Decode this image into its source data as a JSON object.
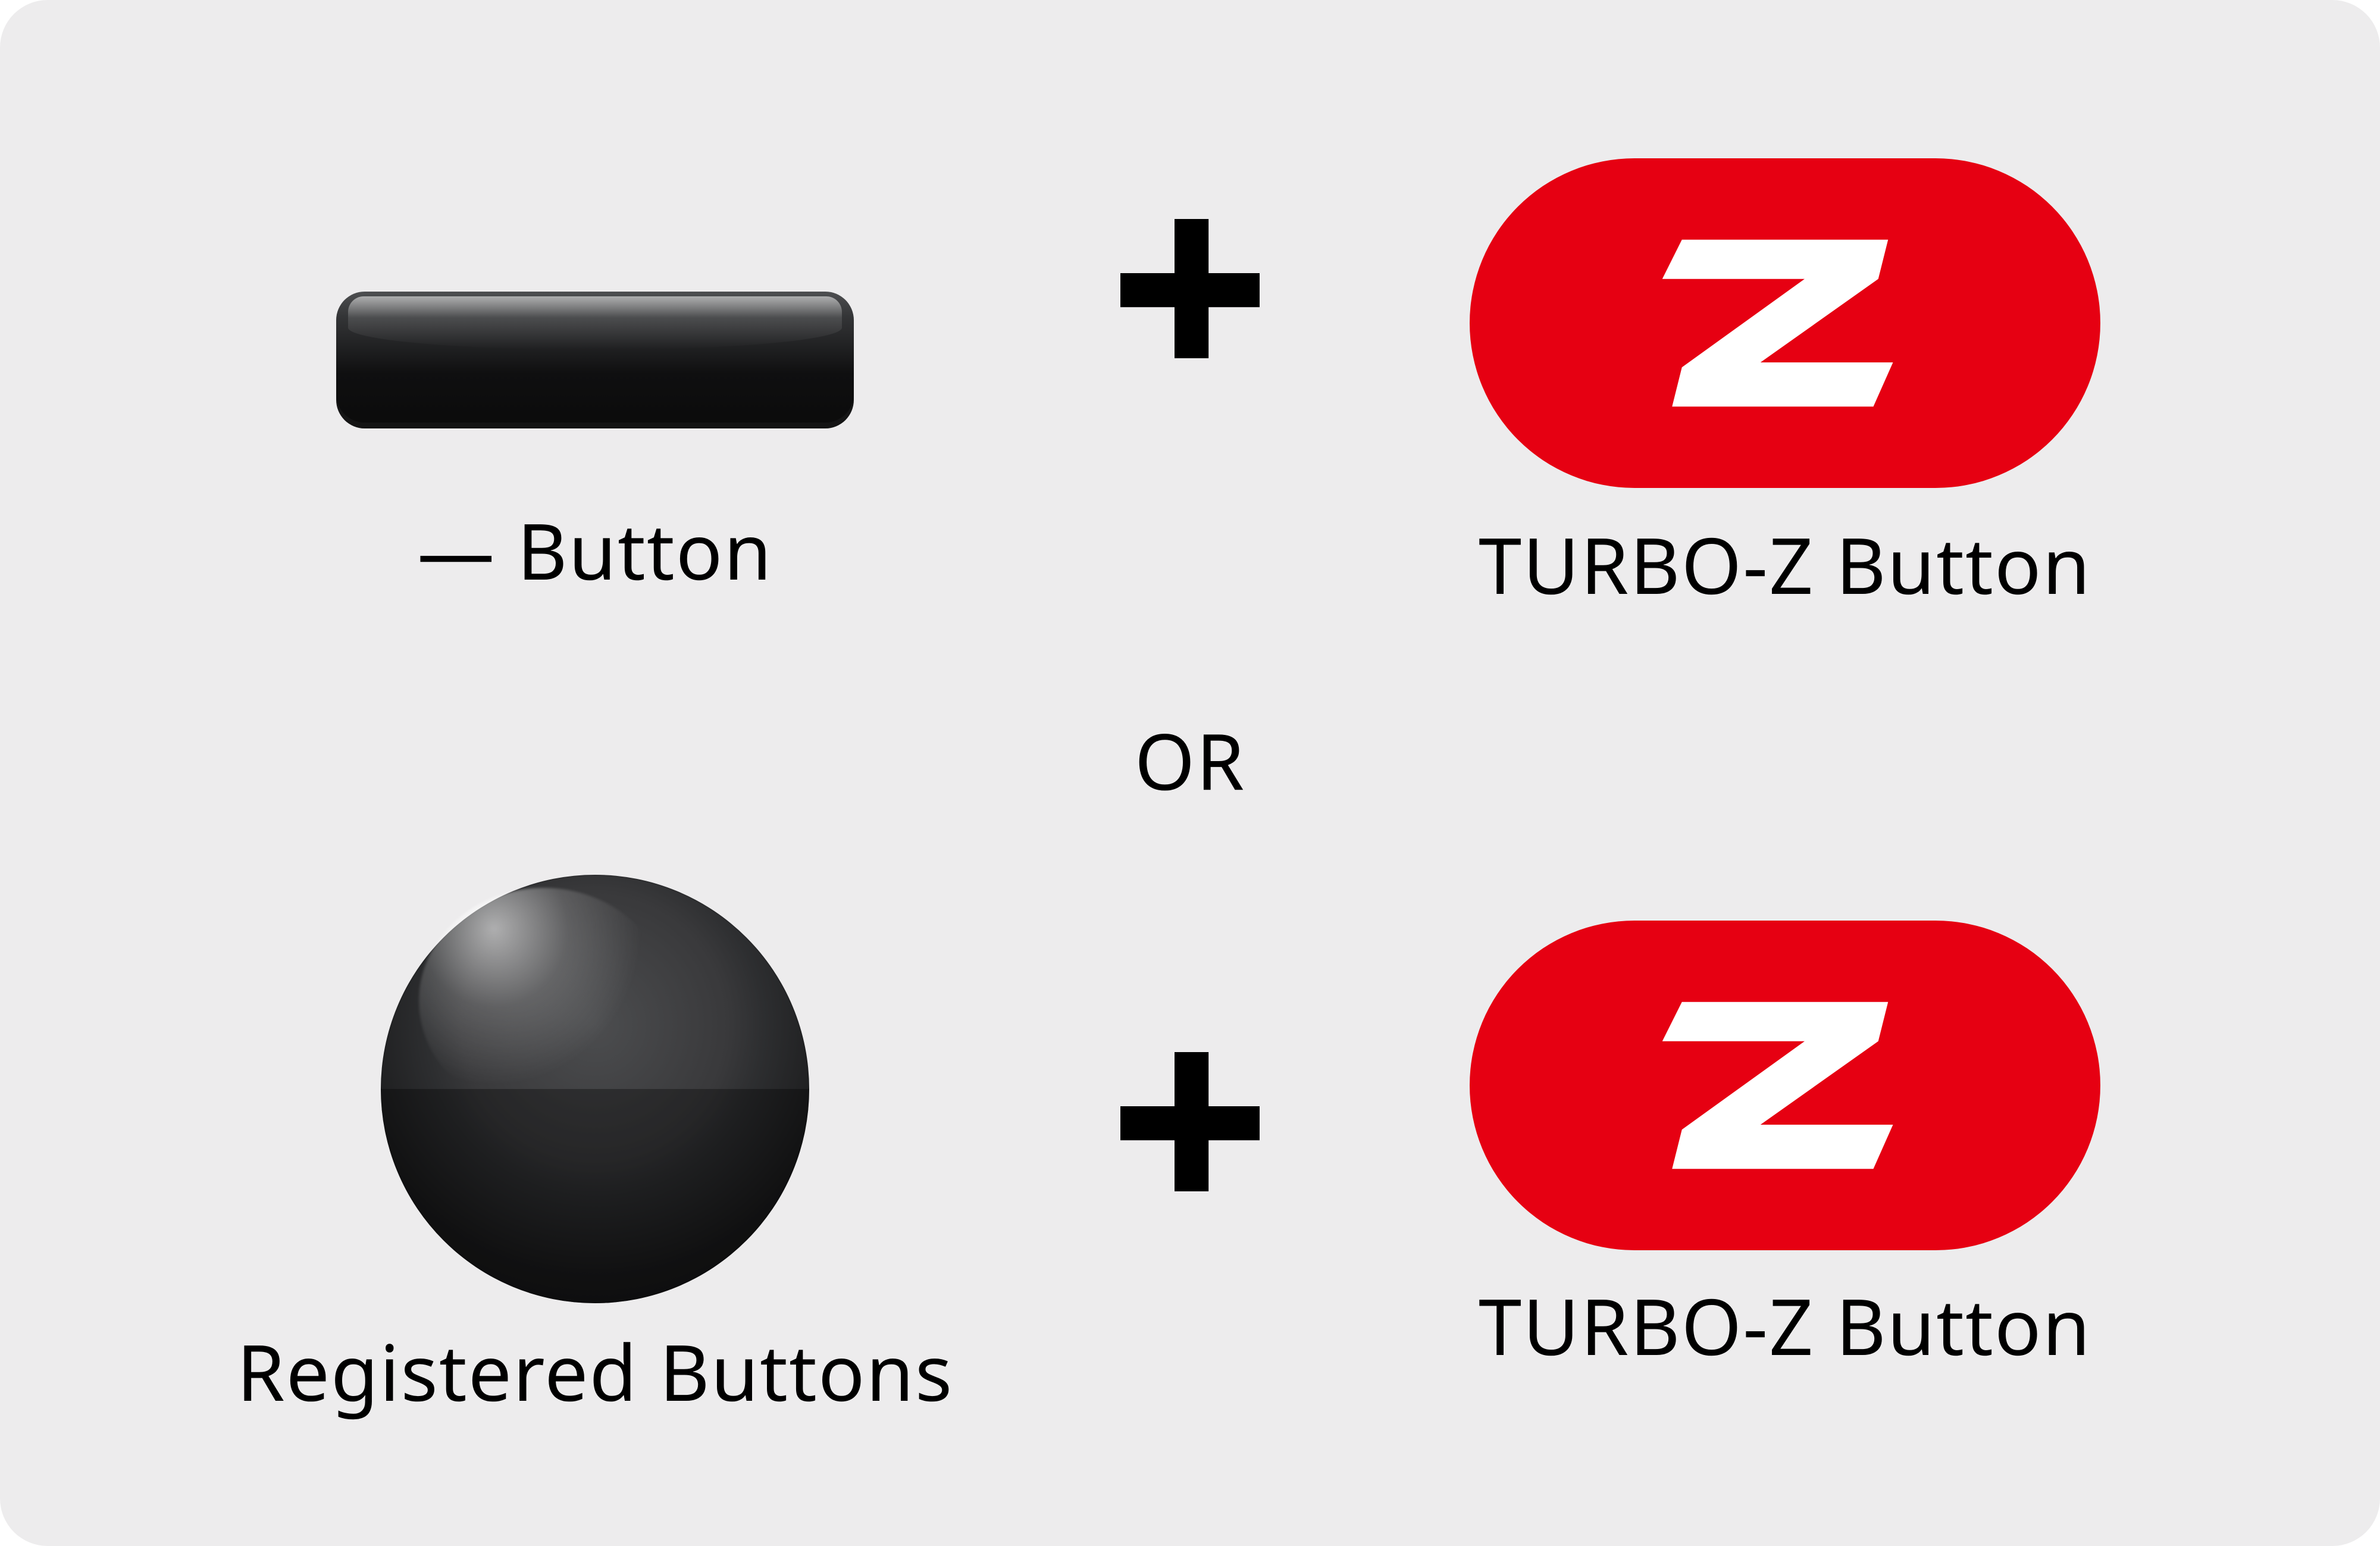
{
  "combo1": {
    "left_label": "— Button",
    "right_label": "TURBO-Z Button"
  },
  "separator": "OR",
  "combo2": {
    "left_label": "Registered Buttons",
    "right_label": "TURBO-Z Button"
  }
}
